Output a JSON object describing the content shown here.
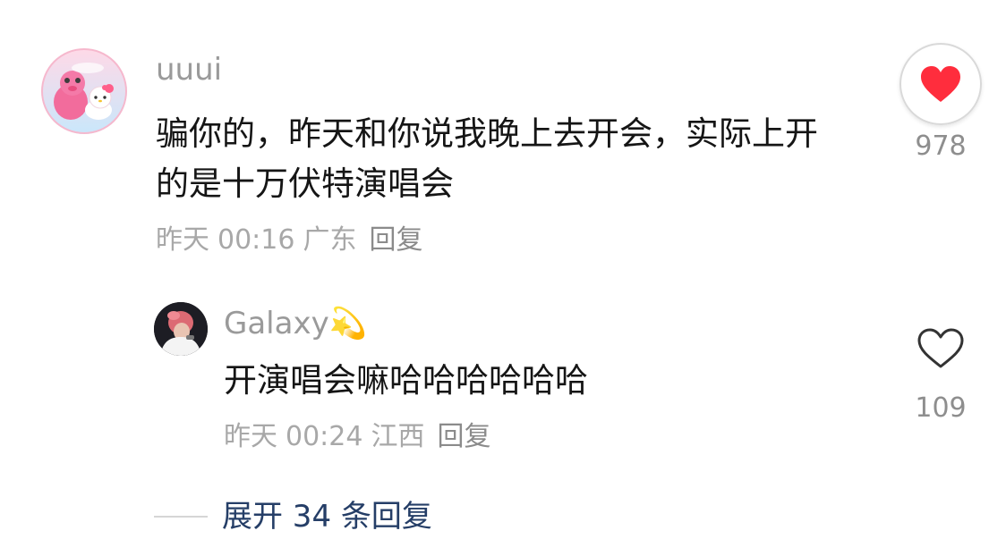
{
  "comment": {
    "username": "uuui",
    "text": "骗你的，昨天和你说我晚上去开会，实际上开的是十万伏特演唱会",
    "date": "昨天",
    "time": "00:16",
    "location": "广东",
    "reply_label": "回复",
    "like_count": "978",
    "liked": true,
    "like_color": "#ff2d3d"
  },
  "reply": {
    "username": "Galaxy",
    "username_emoji": "💫",
    "text": "开演唱会嘛哈哈哈哈哈哈",
    "date": "昨天",
    "time": "00:24",
    "location": "江西",
    "reply_label": "回复",
    "like_count": "109",
    "liked": false
  },
  "expand": {
    "label": "展开 34 条回复",
    "accent": "#253e67"
  },
  "icons": {
    "main_like": "heart-filled-icon",
    "reply_like": "heart-outline-icon"
  }
}
